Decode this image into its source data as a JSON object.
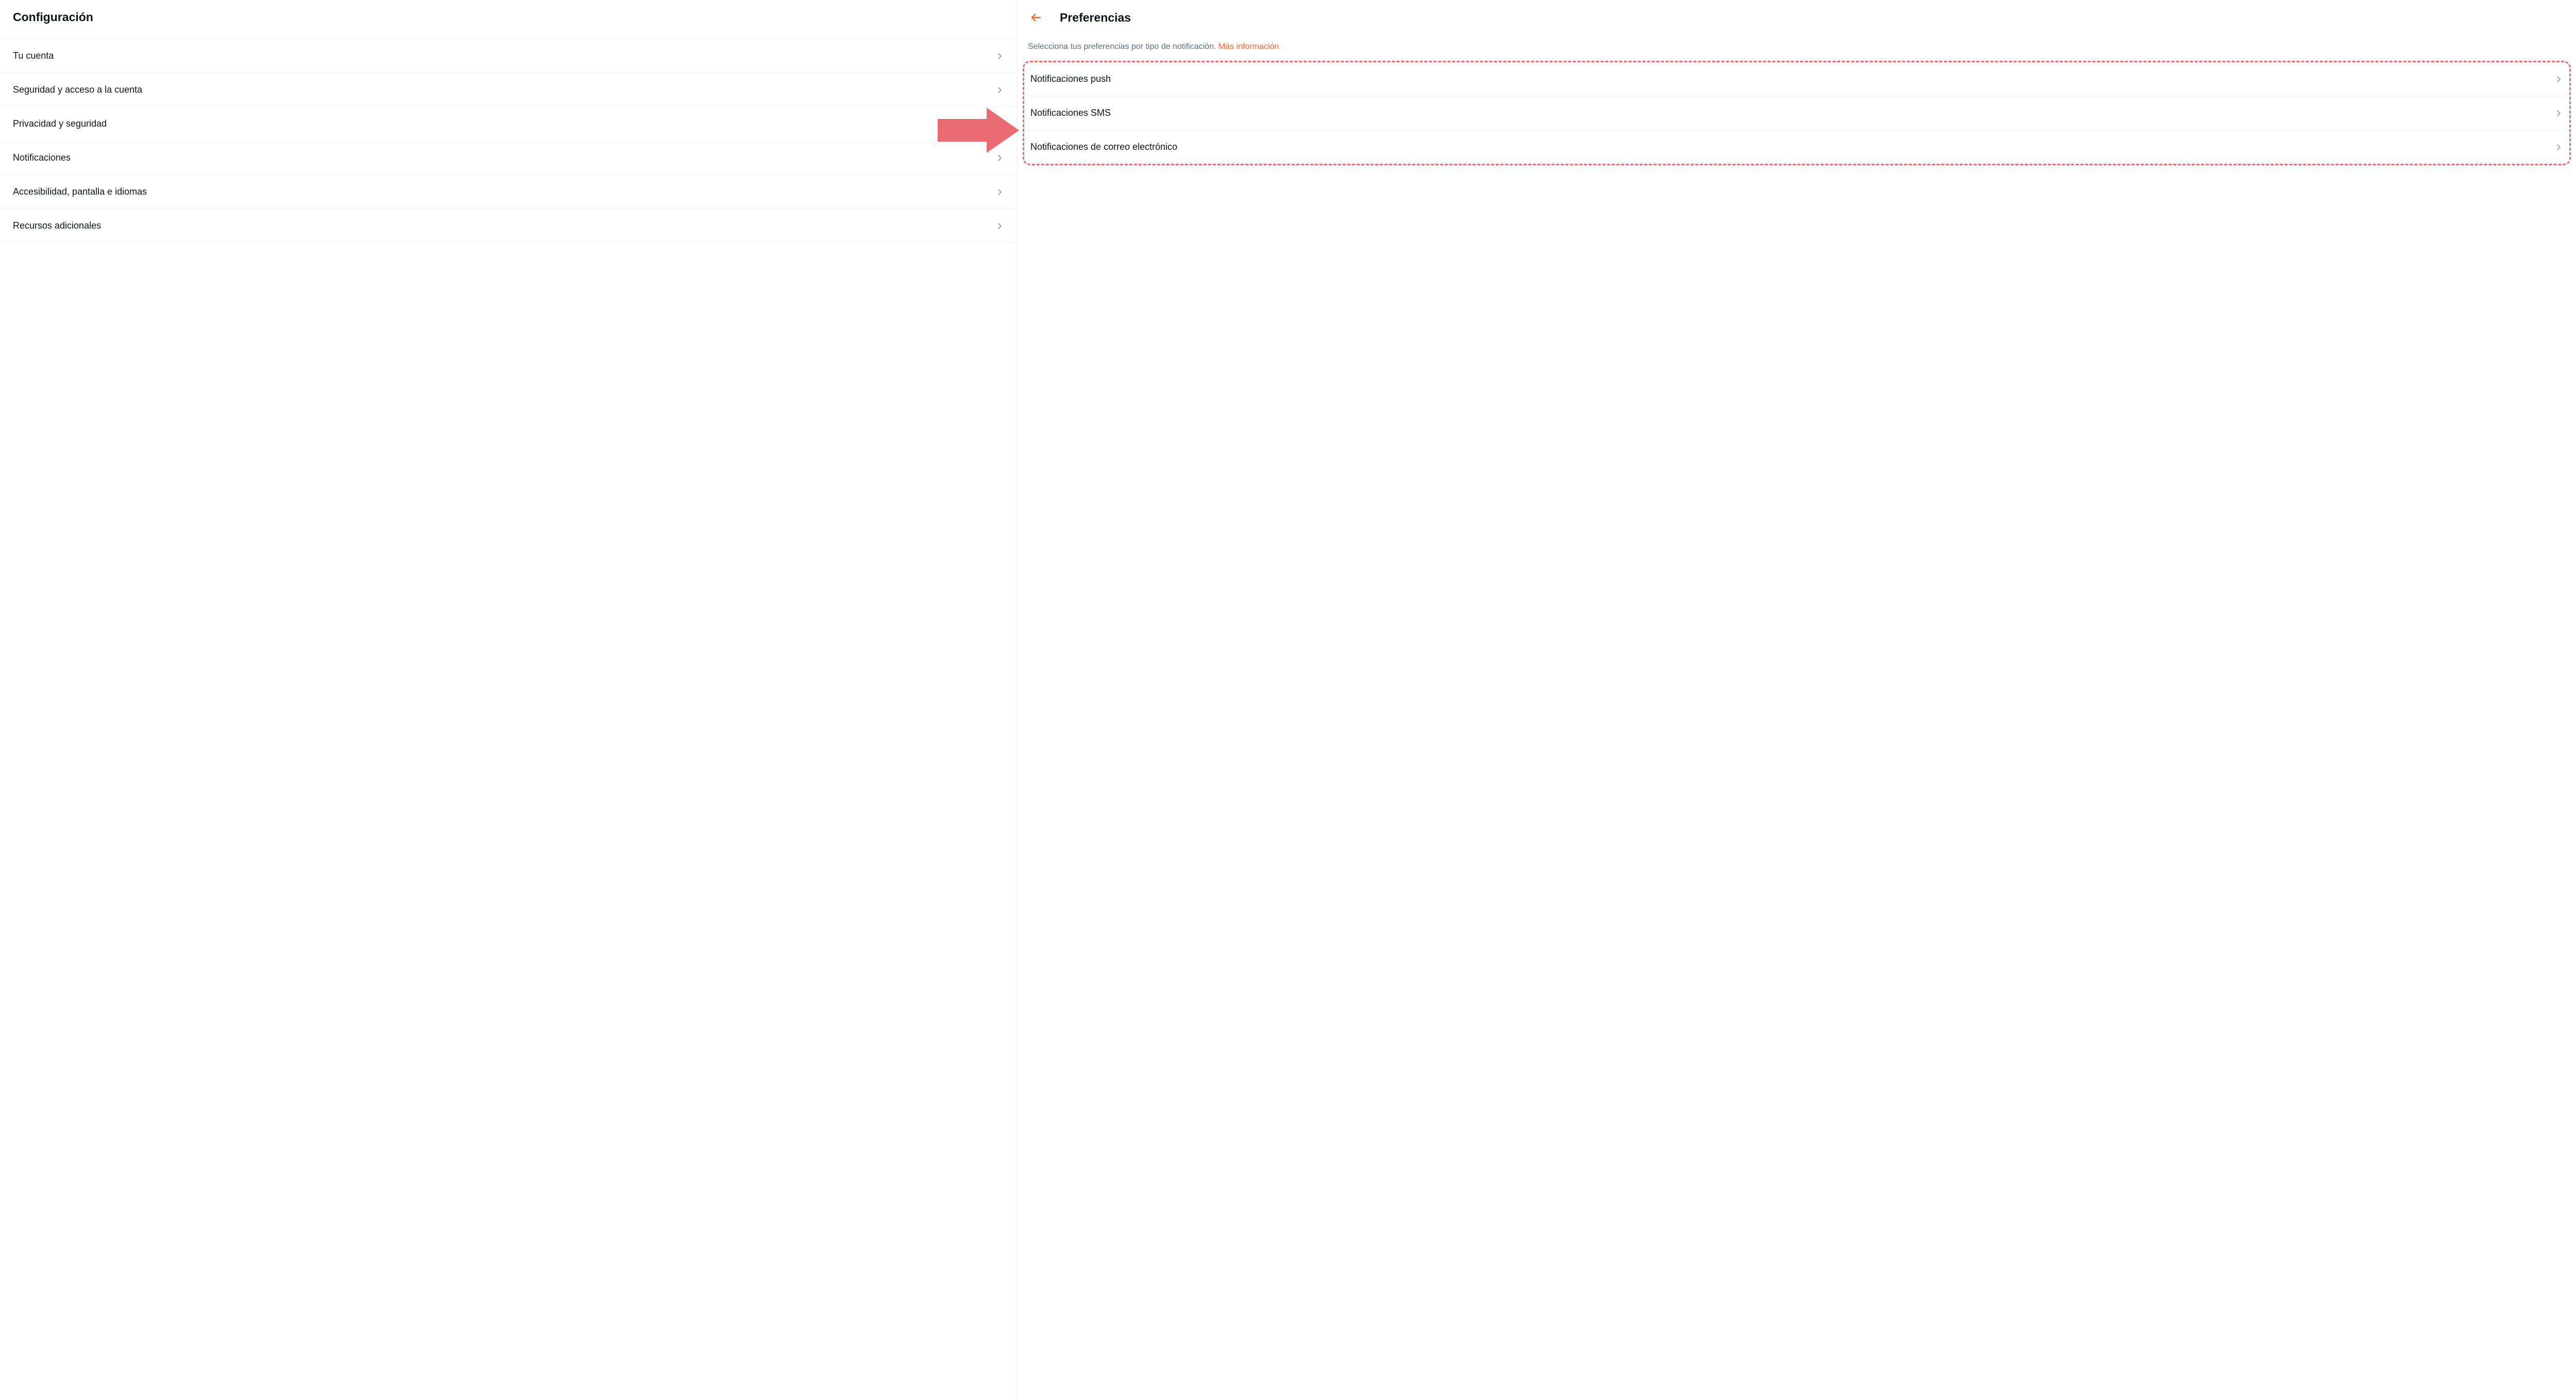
{
  "sidebar": {
    "title": "Configuración",
    "items": [
      {
        "label": "Tu cuenta",
        "name": "sidebar-item-account"
      },
      {
        "label": "Seguridad y acceso a la cuenta",
        "name": "sidebar-item-security"
      },
      {
        "label": "Privacidad y seguridad",
        "name": "sidebar-item-privacy"
      },
      {
        "label": "Notificaciones",
        "name": "sidebar-item-notifications"
      },
      {
        "label": "Accesibilidad, pantalla e idiomas",
        "name": "sidebar-item-accessibility"
      },
      {
        "label": "Recursos adicionales",
        "name": "sidebar-item-resources"
      }
    ]
  },
  "main": {
    "title": "Preferencias",
    "description_text": "Selecciona tus preferencias por tipo de notificación. ",
    "more_info_label": "Más información",
    "preferences": [
      {
        "label": "Notificaciones push",
        "name": "pref-item-push"
      },
      {
        "label": "Notificaciones SMS",
        "name": "pref-item-sms"
      },
      {
        "label": "Notificaciones de correo electrónico",
        "name": "pref-item-email"
      }
    ]
  },
  "annotation": {
    "arrow_color": "#ea6b73",
    "highlight_color": "#ea6b73"
  }
}
